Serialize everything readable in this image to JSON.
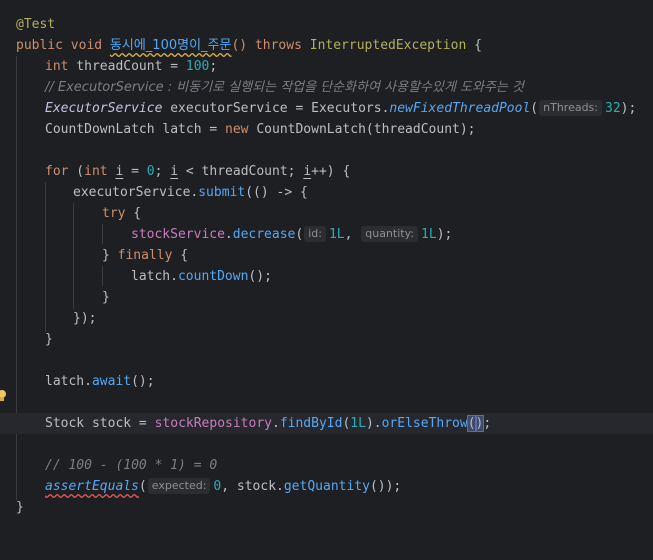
{
  "editor": {
    "annotation": "@Test",
    "signature": {
      "modifiers": "public void ",
      "method_name": "동시에_100명이_주문",
      "parens": "()",
      "throws_kw": " throws ",
      "exception": "InterruptedException",
      "brace": " {"
    },
    "line_thread_count": {
      "type": "int",
      "name": " threadCount",
      "op": " = ",
      "value": "100",
      "end": ";"
    },
    "comment_executor": "// ExecutorService : 비동기로 실행되는 작업을 단순화하여 사용할수있게 도와주는 것",
    "line_executor": {
      "type": "ExecutorService",
      "name": " executorService",
      "op": " = ",
      "cls": "Executors",
      "dot": ".",
      "method": "newFixedThreadPool",
      "open": "(",
      "hint": "nThreads:",
      "arg": "32",
      "close": ");"
    },
    "line_latch": {
      "type": "CountDownLatch",
      "name": " latch",
      "op": " = ",
      "new_kw": "new ",
      "ctor": "CountDownLatch",
      "open": "(",
      "arg": "threadCount",
      "close": ");"
    },
    "line_for": {
      "for_kw": "for",
      "open": " (",
      "int_kw": "int ",
      "i1": "i",
      "assign": " = ",
      "zero": "0",
      "semi1": "; ",
      "i2": "i",
      "lt": " < threadCount; ",
      "i3": "i",
      "inc": "++) {"
    },
    "line_submit": {
      "obj": "executorService",
      "dot": ".",
      "method": "submit",
      "rest": "(() -> {"
    },
    "line_try": {
      "kw": "try",
      "brace": " {"
    },
    "line_decrease": {
      "field": "stockService",
      "dot": ".",
      "method": "decrease",
      "open": "(",
      "hint_id": "id:",
      "arg1": "1L",
      "comma": ", ",
      "hint_qty": "quantity:",
      "arg2": "1L",
      "close": ");"
    },
    "line_finally": {
      "close": "} ",
      "kw": "finally",
      "brace": " {"
    },
    "line_countdown": {
      "obj": "latch",
      "dot": ".",
      "method": "countDown",
      "rest": "();"
    },
    "close_brace": "}",
    "close_lambda": "});",
    "line_await": {
      "obj": "latch",
      "dot": ".",
      "method": "await",
      "rest": "();"
    },
    "line_stock": {
      "type": "Stock",
      "name": " stock",
      "op": " = ",
      "field": "stockRepository",
      "dot1": ".",
      "method1": "findById",
      "open1": "(",
      "arg": "1L",
      "close1": ")",
      "dot2": ".",
      "method2": "orElseThrow",
      "paren_open": "(",
      "paren_close": ")",
      "end": ";"
    },
    "comment_math": "// 100 - (100 * 1) = 0",
    "line_assert": {
      "method": "assertEquals",
      "open": "(",
      "hint": "expected:",
      "arg1": "0",
      "comma": ", ",
      "obj": "stock",
      "dot": ".",
      "getter": "getQuantity",
      "close": "());"
    }
  },
  "colors": {
    "background": "#1e1f22",
    "keyword": "#cf8e6d",
    "method": "#56a8f5",
    "number": "#2aacb8",
    "field": "#c77dbb",
    "comment": "#7a7e85",
    "annotation": "#b3ae60"
  }
}
